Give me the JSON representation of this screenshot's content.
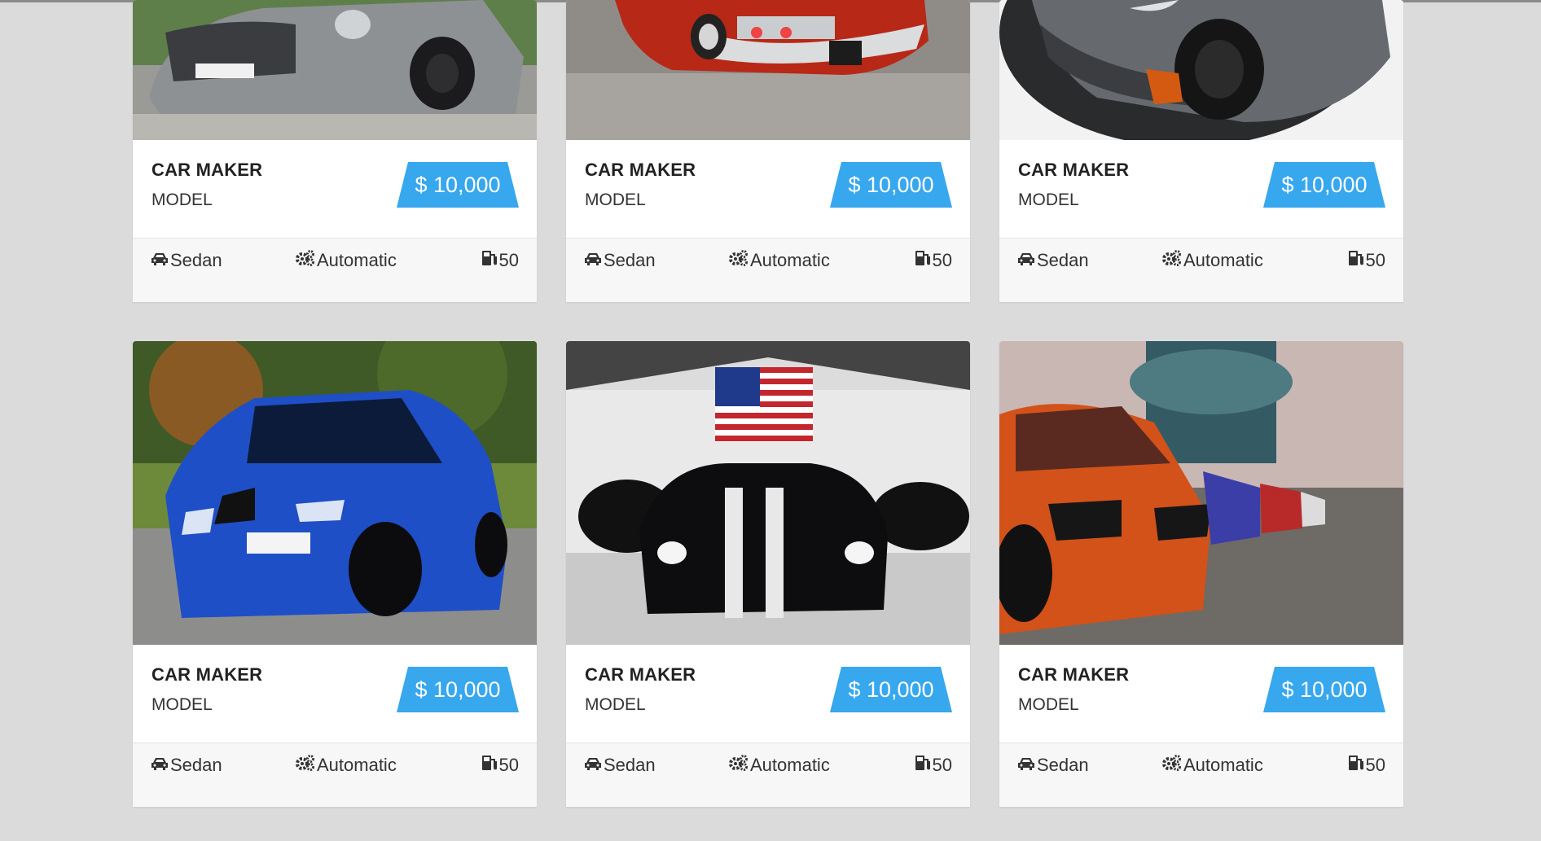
{
  "cards": [
    {
      "maker": "CAR MAKER",
      "model": "MODEL",
      "price": "$ 10,000",
      "body": "Sedan",
      "transmission": "Automatic",
      "fuel": "50"
    },
    {
      "maker": "CAR MAKER",
      "model": "MODEL",
      "price": "$ 10,000",
      "body": "Sedan",
      "transmission": "Automatic",
      "fuel": "50"
    },
    {
      "maker": "CAR MAKER",
      "model": "MODEL",
      "price": "$ 10,000",
      "body": "Sedan",
      "transmission": "Automatic",
      "fuel": "50"
    },
    {
      "maker": "CAR MAKER",
      "model": "MODEL",
      "price": "$ 10,000",
      "body": "Sedan",
      "transmission": "Automatic",
      "fuel": "50"
    },
    {
      "maker": "CAR MAKER",
      "model": "MODEL",
      "price": "$ 10,000",
      "body": "Sedan",
      "transmission": "Automatic",
      "fuel": "50"
    },
    {
      "maker": "CAR MAKER",
      "model": "MODEL",
      "price": "$ 10,000",
      "body": "Sedan",
      "transmission": "Automatic",
      "fuel": "50"
    }
  ],
  "icons": {
    "body": "car-icon",
    "transmission": "gears-icon",
    "fuel": "gas-pump-icon"
  },
  "colors": {
    "background": "#dcdbdc",
    "price_tag": "#37a7ee",
    "specs_bg": "#f7f7f7"
  }
}
